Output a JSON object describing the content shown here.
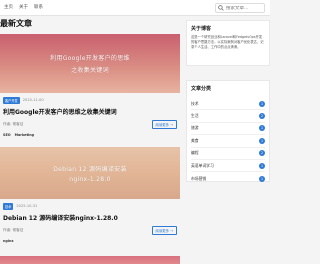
{
  "nav": {
    "items": [
      "主页",
      "关于",
      "联系"
    ]
  },
  "search": {
    "placeholder": "搜索文章..."
  },
  "page": {
    "title": "最新文章"
  },
  "posts": [
    {
      "image_lines": [
        "利用Google开发客户的思维",
        "之收集关键词"
      ],
      "category": "客户开发",
      "date": "2025-11-00",
      "title": "利用Google开发客户的思维之收集关键词",
      "author": "作者: 常客征",
      "read_more": "阅读更多 →",
      "tags": [
        "SEO",
        "Marketing"
      ],
      "gradient": [
        "#c95f6f",
        "#d98c83",
        "#e8b3a0"
      ]
    },
    {
      "image_lines": [
        "Debian 12 源码编译安装",
        "nginx-1.28.0"
      ],
      "category": "技术",
      "date": "2025-10-31",
      "title": "Debian 12 源码编译安装nginx-1.28.0",
      "author": "作者: 常客征",
      "read_more": "阅读更多 →",
      "tags": [
        "nginx"
      ],
      "gradient": [
        "#e6c3a8",
        "#e2b596",
        "#d8a88c"
      ]
    },
    {
      "gradient": [
        "#d87080",
        "#e08a8c",
        "#e8a4a0"
      ]
    }
  ],
  "sidebar": {
    "about": {
      "heading": "关于博客",
      "text": "这是一个研究创业和Laravel和FedgetsOps开发的客户思路方法，以实际案例对客户优化表达，记录个人生活、工作中的点点滴滴。"
    },
    "categories": {
      "heading": "文章分类",
      "items": [
        {
          "name": "技术",
          "count": "1"
        },
        {
          "name": "生活",
          "count": "2"
        },
        {
          "name": "旅游",
          "count": "1"
        },
        {
          "name": "美食",
          "count": "1"
        },
        {
          "name": "编程",
          "count": "2"
        },
        {
          "name": "英语单词学习",
          "count": "1"
        },
        {
          "name": "市场营销",
          "count": "1"
        }
      ]
    }
  },
  "colors": {
    "accent": "#2f7ad6",
    "background": "#f4f4f4"
  }
}
